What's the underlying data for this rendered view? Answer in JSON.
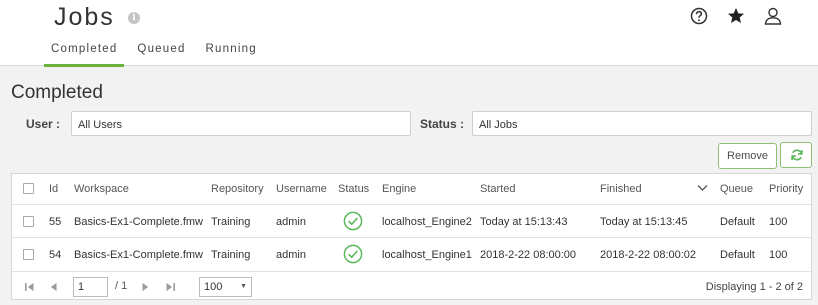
{
  "header": {
    "title": "Jobs",
    "tabs": [
      "Completed",
      "Queued",
      "Running"
    ],
    "active_tab": "Completed",
    "icons": [
      "info-icon",
      "help-icon",
      "star-icon",
      "user-icon"
    ]
  },
  "main": {
    "section_title": "Completed",
    "filters": {
      "user_label": "User :",
      "user_value": "All Users",
      "status_label": "Status :",
      "status_value": "All Jobs"
    },
    "buttons": {
      "remove": "Remove",
      "refresh_icon": "refresh-icon"
    }
  },
  "table": {
    "columns": [
      "Id",
      "Workspace",
      "Repository",
      "Username",
      "Status",
      "Engine",
      "Started",
      "Finished",
      "Queue",
      "Priority"
    ],
    "sort_column": "Finished",
    "sort_direction": "descending",
    "rows": [
      {
        "id": "55",
        "workspace": "Basics-Ex1-Complete.fmw",
        "repository": "Training",
        "username": "admin",
        "status": "success",
        "engine": "localhost_Engine2",
        "started": "Today at 15:13:43",
        "finished": "Today at 15:13:45",
        "queue": "Default",
        "priority": "100"
      },
      {
        "id": "54",
        "workspace": "Basics-Ex1-Complete.fmw",
        "repository": "Training",
        "username": "admin",
        "status": "success",
        "engine": "localhost_Engine1",
        "started": "2018-2-22 08:00:00",
        "finished": "2018-2-22 08:00:02",
        "queue": "Default",
        "priority": "100"
      }
    ]
  },
  "pager": {
    "page": "1",
    "total_pages": "/ 1",
    "page_size": "100",
    "displaying": "Displaying 1 - 2 of 2"
  },
  "colors": {
    "accent": "#6cb33f",
    "success": "#5cb85c",
    "background": "#f2f2f2"
  }
}
